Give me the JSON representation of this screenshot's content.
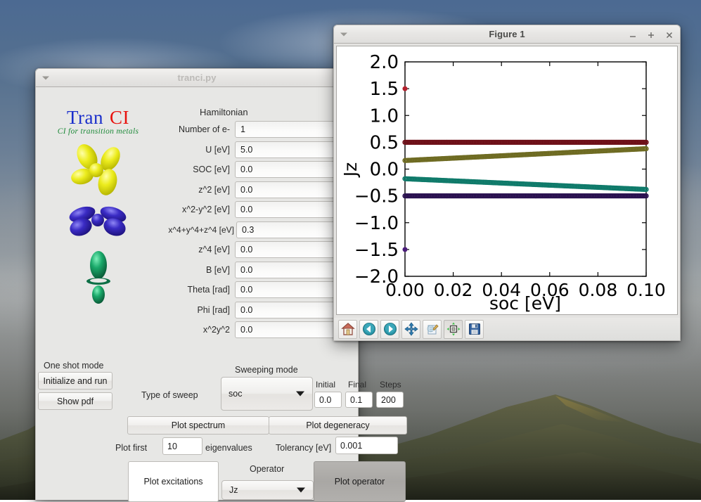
{
  "desktop": {
    "wallpaper_description": "mountain-landscape-with-clouds"
  },
  "app_window": {
    "title": "tranci.py",
    "logo": {
      "word1": "Tran",
      "word2": "CI",
      "tagline": "CI for transition metals",
      "word1_color": "#1a2ecb",
      "word2_color": "#e8120e",
      "tagline_color": "#1f8a3a",
      "orbitals": [
        {
          "name": "d-orbital-yellow",
          "color": "#e8e817"
        },
        {
          "name": "d-orbital-blue",
          "color": "#2a1fb0"
        },
        {
          "name": "dz2-orbital-green",
          "color": "#17a263"
        }
      ]
    },
    "hamiltonian": {
      "header": "Hamiltonian",
      "fields": [
        {
          "label": "Number of e-",
          "value": "1"
        },
        {
          "label": "U [eV]",
          "value": "5.0"
        },
        {
          "label": "SOC [eV]",
          "value": "0.0"
        },
        {
          "label": "z^2 [eV]",
          "value": "0.0"
        },
        {
          "label": "x^2-y^2 [eV]",
          "value": "0.0"
        },
        {
          "label": "x^4+y^4+z^4 [eV]",
          "value": "0.3"
        },
        {
          "label": "z^4 [eV]",
          "value": "0.0"
        },
        {
          "label": "B [eV]",
          "value": "0.0"
        },
        {
          "label": "Theta [rad]",
          "value": "0.0"
        },
        {
          "label": "Phi [rad]",
          "value": "0.0"
        },
        {
          "label": "x^2y^2",
          "value": "0.0"
        }
      ]
    },
    "one_shot": {
      "header": "One shot mode",
      "initialize_button": "Initialize and run",
      "show_pdf_button": "Show pdf"
    },
    "sweeping": {
      "header": "Sweeping mode",
      "type_label": "Type of sweep",
      "type_value": "soc",
      "initial_label": "Initial",
      "initial_value": "0.0",
      "final_label": "Final",
      "final_value": "0.1",
      "steps_label": "Steps",
      "steps_value": "200"
    },
    "plot_row": {
      "plot_spectrum_button": "Plot spectrum",
      "plot_degeneracy_button": "Plot degeneracy"
    },
    "eigen_row": {
      "plot_first_label": "Plot first",
      "plot_first_value": "10",
      "eigenvalues_label": "eigenvalues",
      "tolerancy_label": "Tolerancy [eV]",
      "tolerancy_value": "0.001"
    },
    "operator_row": {
      "plot_excitations_button": "Plot excitations",
      "operator_header": "Operator",
      "operator_value": "Jz",
      "plot_operator_button": "Plot operator"
    }
  },
  "figure_window": {
    "title": "Figure 1",
    "window_buttons": [
      {
        "name": "minimize-button",
        "glyph": "minimize-icon"
      },
      {
        "name": "maximize-button",
        "glyph": "maximize-icon"
      },
      {
        "name": "close-button",
        "glyph": "close-icon"
      }
    ],
    "toolbar": [
      {
        "name": "home-icon",
        "tooltip": "Reset original view"
      },
      {
        "name": "back-arrow-icon",
        "tooltip": "Back to previous view"
      },
      {
        "name": "forward-arrow-icon",
        "tooltip": "Forward to next view"
      },
      {
        "name": "pan-move-icon",
        "tooltip": "Pan axes with left mouse, zoom with right"
      },
      {
        "name": "configure-subplots-icon",
        "tooltip": "Configure subplots"
      },
      {
        "name": "zoom-to-rectangle-icon",
        "tooltip": "Zoom to rectangle"
      },
      {
        "name": "save-floppy-icon",
        "tooltip": "Save the figure"
      }
    ]
  },
  "chart_data": {
    "type": "scatter",
    "title": "",
    "xlabel": "soc  [eV]",
    "ylabel": "Jz",
    "xlim": [
      0.0,
      0.1
    ],
    "ylim": [
      -2.0,
      2.0
    ],
    "xticks": [
      "0.00",
      "0.02",
      "0.04",
      "0.06",
      "0.08",
      "0.10"
    ],
    "xtick_values": [
      0.0,
      0.02,
      0.04,
      0.06,
      0.08,
      0.1
    ],
    "yticks": [
      "2.0",
      "1.5",
      "1.0",
      "0.5",
      "0.0",
      "-0.5",
      "-1.0",
      "-1.5",
      "-2.0"
    ],
    "ytick_values": [
      2.0,
      1.5,
      1.0,
      0.5,
      0.0,
      -0.5,
      -1.0,
      -1.5,
      -2.0
    ],
    "grid": false,
    "legend": "none",
    "series": [
      {
        "name": "level-1-red-point",
        "color": "#b3202c",
        "marker": "o",
        "x": [
          0.0
        ],
        "y": [
          1.5
        ]
      },
      {
        "name": "level-2-dark-red",
        "color": "#6e1018",
        "marker": "o",
        "y_start": 0.5,
        "y_end": 0.5
      },
      {
        "name": "level-3-olive",
        "color": "#6e6b22",
        "marker": "o",
        "y_start": 0.16,
        "y_end": 0.38
      },
      {
        "name": "level-4-teal",
        "color": "#0f7a6a",
        "marker": "o",
        "y_start": -0.18,
        "y_end": -0.38
      },
      {
        "name": "level-5-purple",
        "color": "#2a1150",
        "marker": "o",
        "y_start": -0.5,
        "y_end": -0.5
      },
      {
        "name": "level-6-purple-point",
        "color": "#4b1d7a",
        "marker": "o",
        "x": [
          0.0
        ],
        "y": [
          -1.5
        ]
      }
    ]
  }
}
